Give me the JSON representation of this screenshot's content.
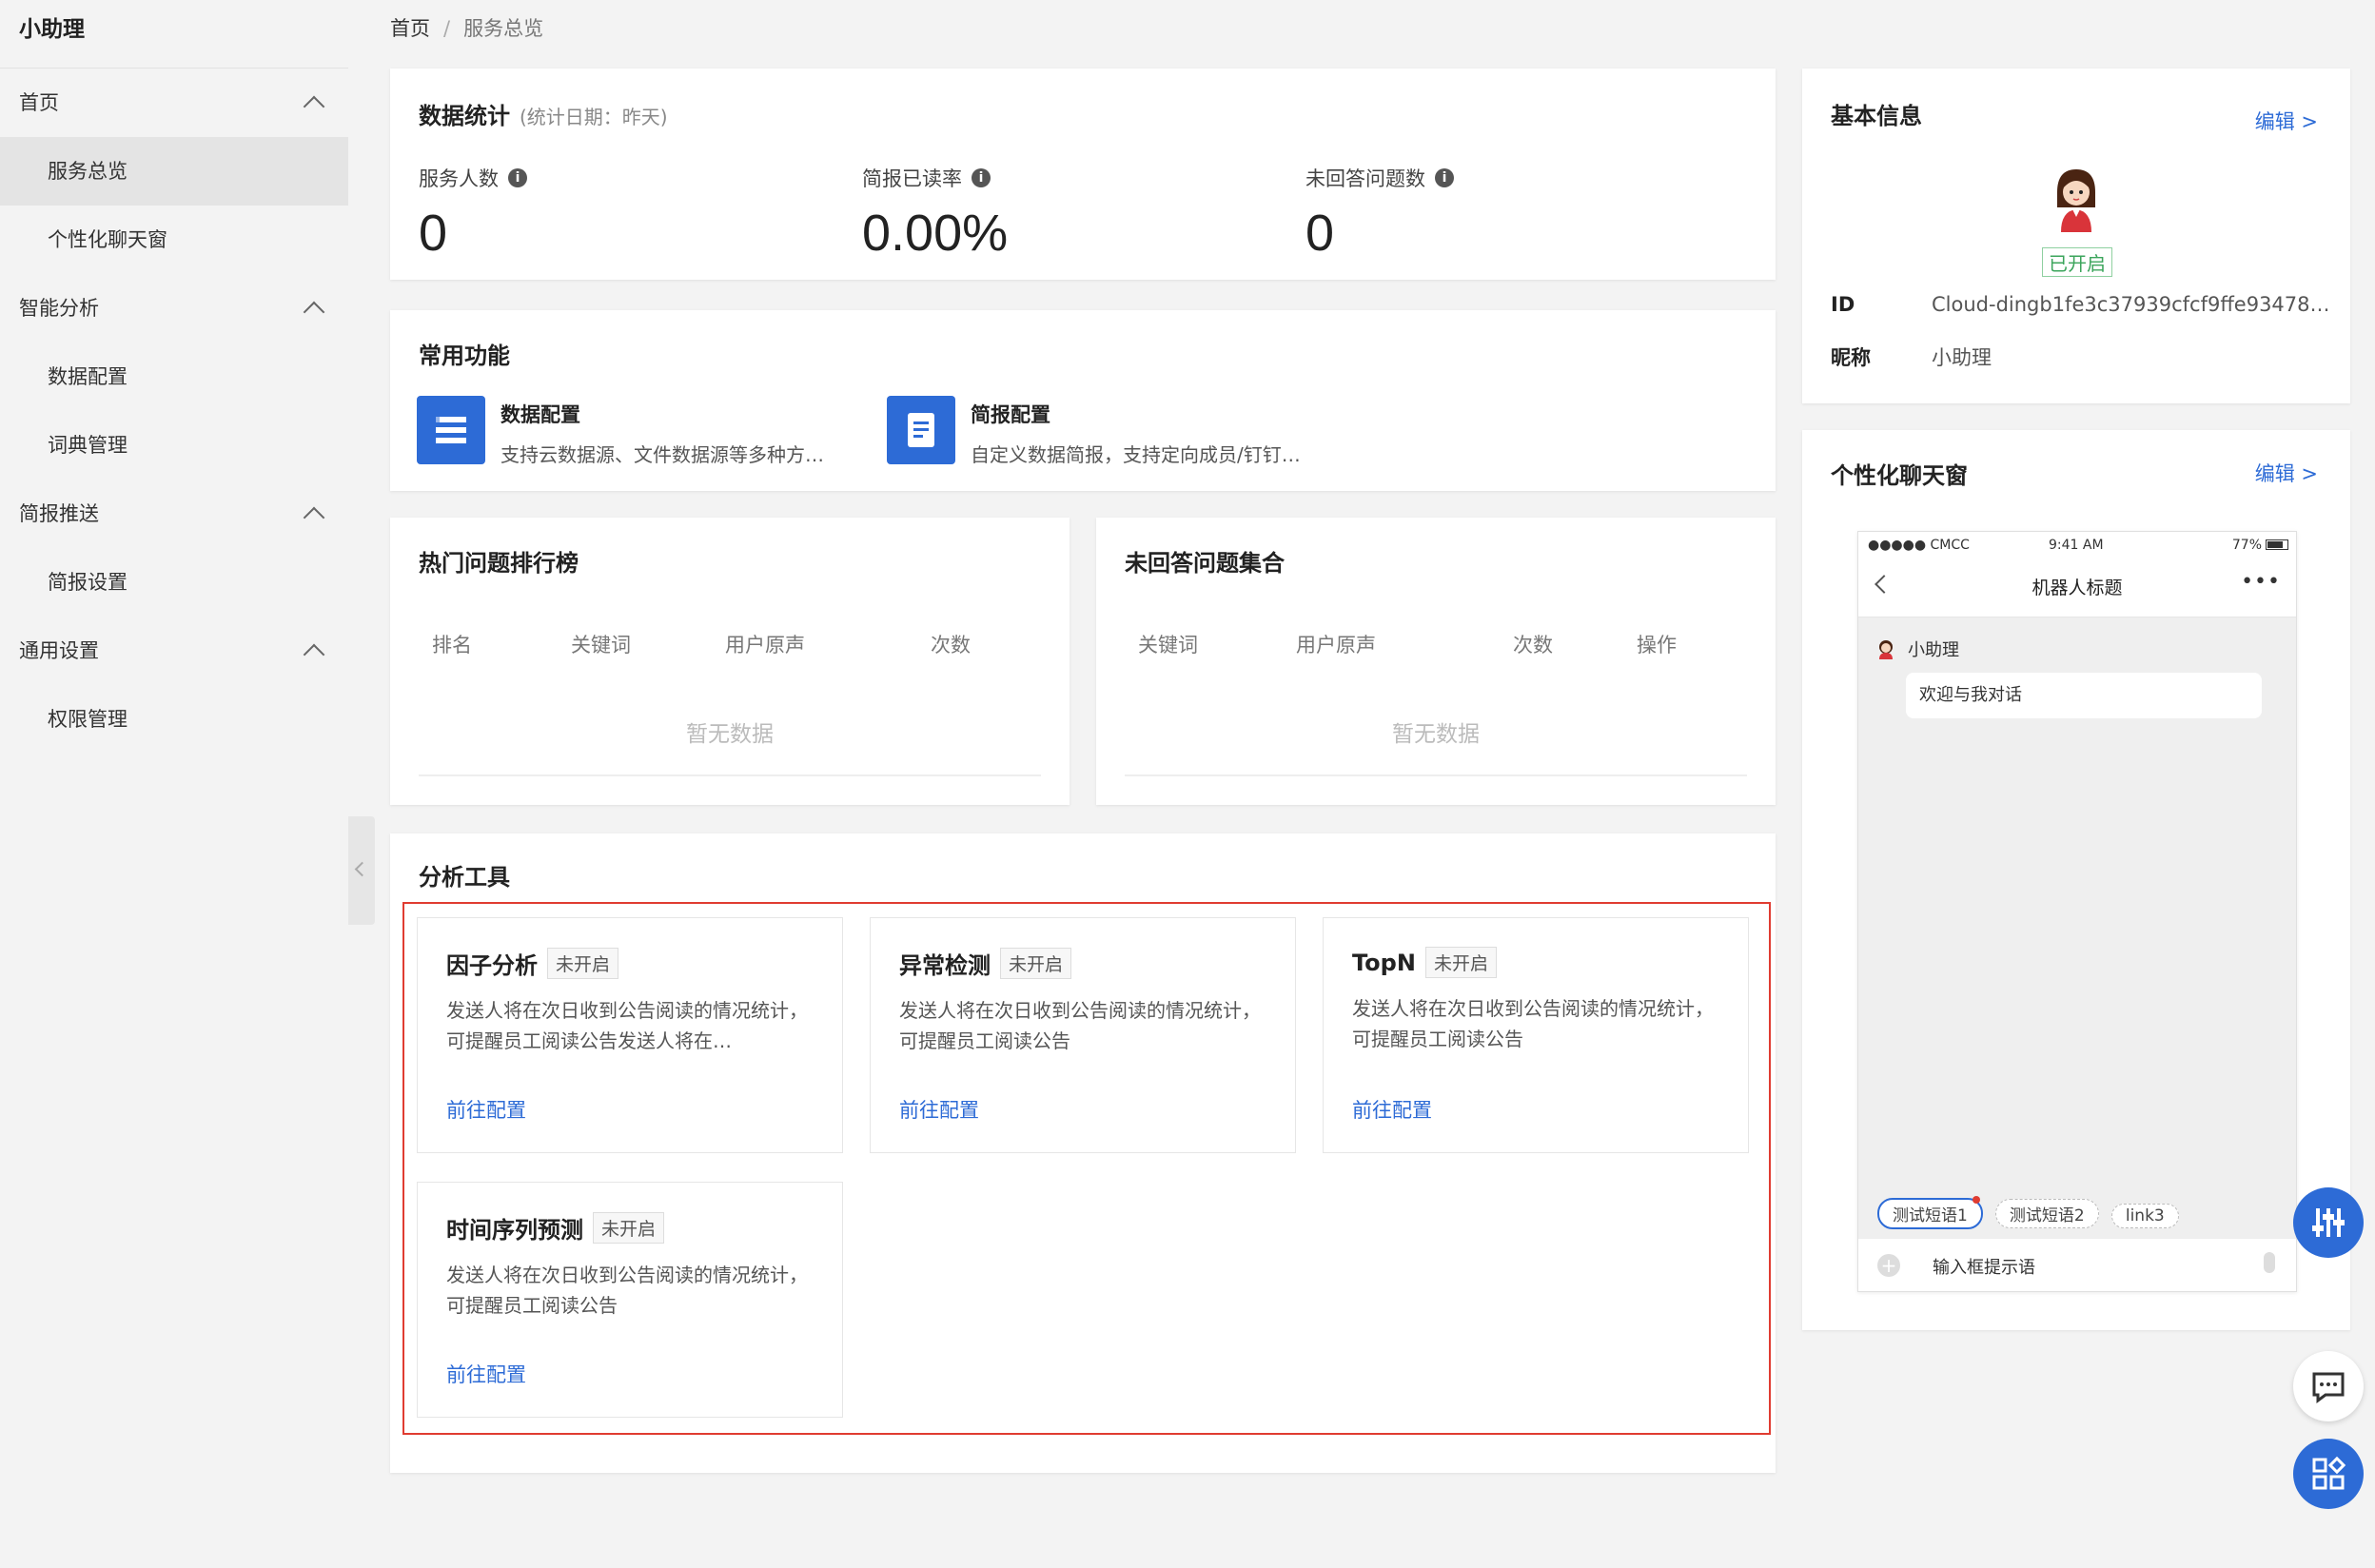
{
  "sidebar": {
    "title": "小助理",
    "groups": [
      {
        "label": "首页",
        "items": [
          "服务总览",
          "个性化聊天窗"
        ]
      },
      {
        "label": "智能分析",
        "items": [
          "数据配置",
          "词典管理"
        ]
      },
      {
        "label": "简报推送",
        "items": [
          "简报设置"
        ]
      },
      {
        "label": "通用设置",
        "items": [
          "权限管理"
        ]
      }
    ],
    "active_item": "服务总览"
  },
  "breadcrumb": {
    "home": "首页",
    "sep": "/",
    "current": "服务总览"
  },
  "stats": {
    "title": "数据统计",
    "subtitle": "(统计日期：昨天)",
    "items": [
      {
        "label": "服务人数",
        "value": "0"
      },
      {
        "label": "简报已读率",
        "value": "0.00%"
      },
      {
        "label": "未回答问题数",
        "value": "0"
      }
    ]
  },
  "features": {
    "title": "常用功能",
    "items": [
      {
        "name": "数据配置",
        "desc": "支持云数据源、文件数据源等多种方…",
        "icon": "list-icon"
      },
      {
        "name": "简报配置",
        "desc": "自定义数据简报，支持定向成员/钉钉…",
        "icon": "document-icon"
      }
    ]
  },
  "hot": {
    "title": "热门问题排行榜",
    "columns": [
      "排名",
      "关键词",
      "用户原声",
      "次数"
    ],
    "empty": "暂无数据"
  },
  "unanswered": {
    "title": "未回答问题集合",
    "columns": [
      "关键词",
      "用户原声",
      "次数",
      "操作"
    ],
    "empty": "暂无数据"
  },
  "tools": {
    "title": "分析工具",
    "items": [
      {
        "name": "因子分析",
        "badge": "未开启",
        "desc": "发送人将在次日收到公告阅读的情况统计，可提醒员工阅读公告发送人将在…",
        "link": "前往配置"
      },
      {
        "name": "异常检测",
        "badge": "未开启",
        "desc": "发送人将在次日收到公告阅读的情况统计，可提醒员工阅读公告",
        "link": "前往配置"
      },
      {
        "name": "TopN",
        "badge": "未开启",
        "desc": "发送人将在次日收到公告阅读的情况统计，可提醒员工阅读公告",
        "link": "前往配置"
      },
      {
        "name": "时间序列预测",
        "badge": "未开启",
        "desc": "发送人将在次日收到公告阅读的情况统计，可提醒员工阅读公告",
        "link": "前往配置"
      }
    ]
  },
  "basic_info": {
    "title": "基本信息",
    "edit": "编辑",
    "status": "已开启",
    "id_label": "ID",
    "id_value": "Cloud-dingb1fe3c37939cfcf9ffe93478…",
    "nick_label": "昵称",
    "nick_value": "小助理"
  },
  "chat_window": {
    "title": "个性化聊天窗",
    "edit": "编辑",
    "phone": {
      "carrier": "●●●●● CMCC",
      "time": "9:41 AM",
      "battery": "77%",
      "header_title": "机器人标题",
      "bot_name": "小助理",
      "welcome": "欢迎与我对话",
      "chips": [
        "测试短语1",
        "测试短语2",
        "link3"
      ],
      "input_placeholder": "输入框提示语"
    }
  },
  "colors": {
    "accent": "#2d6bd6",
    "highlight_border": "#e03c31",
    "status_green": "#3ca55c"
  }
}
